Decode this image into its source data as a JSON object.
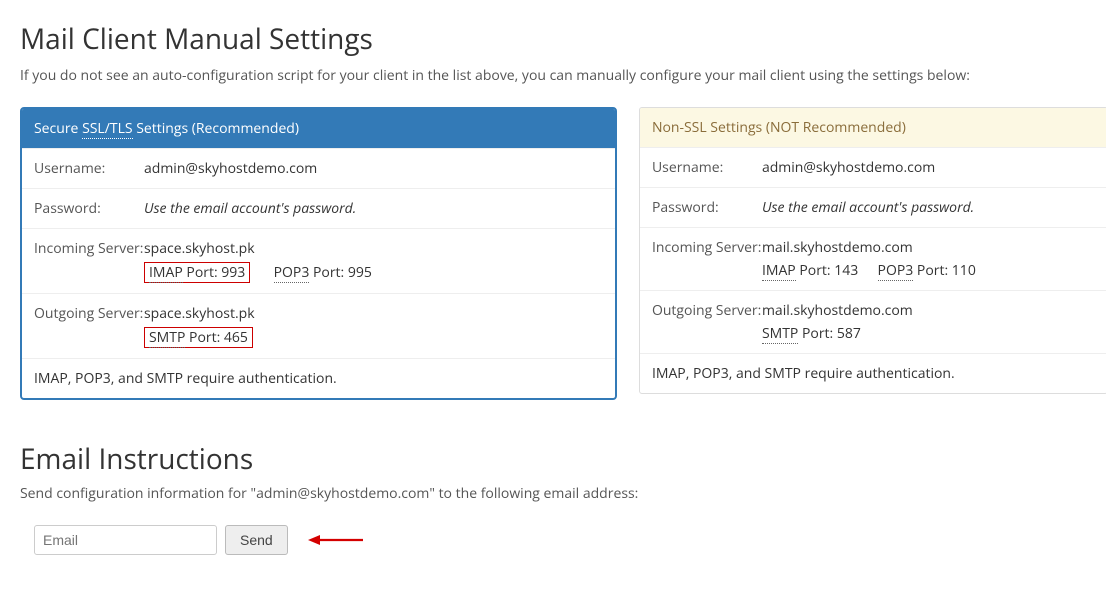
{
  "heading": "Mail Client Manual Settings",
  "subtitle": "If you do not see an auto-configuration script for your client in the list above, you can manually configure your mail client using the settings below:",
  "ssl": {
    "title_prefix": "Secure ",
    "title_protocol": "SSL/TLS",
    "title_suffix": " Settings (Recommended)",
    "username_label": "Username:",
    "username_value": "admin@skyhostdemo.com",
    "password_label": "Password:",
    "password_value": "Use the email account's password.",
    "incoming_label": "Incoming Server:",
    "incoming_host": "space.skyhost.pk",
    "imap_proto": "IMAP",
    "imap_port_text": " Port: 993",
    "pop3_proto": "POP3",
    "pop3_port_text": " Port: 995",
    "outgoing_label": "Outgoing Server:",
    "outgoing_host": "space.skyhost.pk",
    "smtp_proto": "SMTP",
    "smtp_port_text": " Port: 465",
    "footer": "IMAP, POP3, and SMTP require authentication."
  },
  "nonssl": {
    "title": "Non-SSL Settings (NOT Recommended)",
    "username_label": "Username:",
    "username_value": "admin@skyhostdemo.com",
    "password_label": "Password:",
    "password_value": "Use the email account's password.",
    "incoming_label": "Incoming Server:",
    "incoming_host": "mail.skyhostdemo.com",
    "imap_proto": "IMAP",
    "imap_port_text": " Port: 143",
    "pop3_proto": "POP3",
    "pop3_port_text": " Port: 110",
    "outgoing_label": "Outgoing Server:",
    "outgoing_host": "mail.skyhostdemo.com",
    "smtp_proto": "SMTP",
    "smtp_port_text": " Port: 587",
    "footer": "IMAP, POP3, and SMTP require authentication."
  },
  "email_instructions": {
    "heading": "Email Instructions",
    "text": "Send configuration information for \"admin@skyhostdemo.com\" to the following email address:",
    "placeholder": "Email",
    "send_label": "Send"
  }
}
